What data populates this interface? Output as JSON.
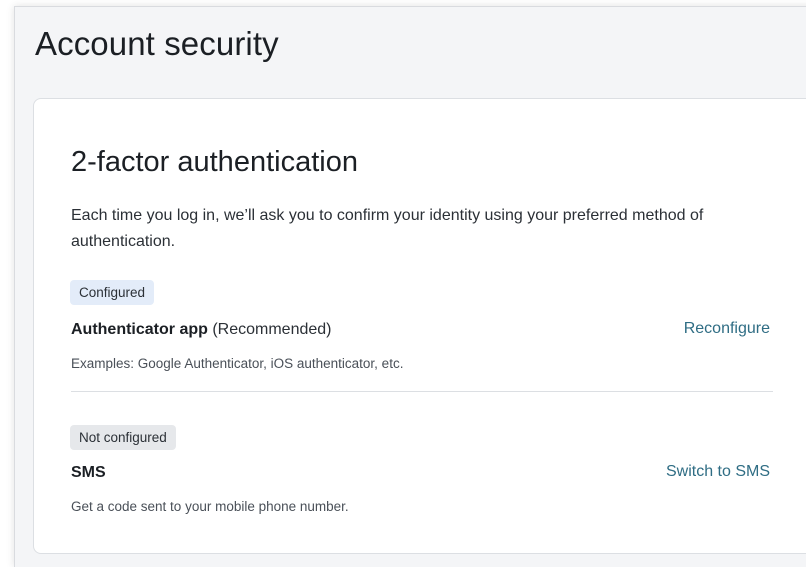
{
  "page": {
    "title": "Account security"
  },
  "two_factor": {
    "title": "2-factor authentication",
    "description": "Each time you log in, we’ll ask you to confirm your identity using your preferred method of authentication.",
    "methods": [
      {
        "status": "Configured",
        "name": "Authenticator app",
        "note": "(Recommended)",
        "example": "Examples: Google Authenticator, iOS authenticator, etc.",
        "action": "Reconfigure"
      },
      {
        "status": "Not configured",
        "name": "SMS",
        "note": "",
        "example": "Get a code sent to your mobile phone number.",
        "action": "Switch to SMS"
      }
    ]
  },
  "colors": {
    "link": "#2f6d84",
    "configured_badge": "#e3ecf9",
    "not_configured_badge": "#e6e8eb",
    "page_background": "#f4f5f7"
  }
}
